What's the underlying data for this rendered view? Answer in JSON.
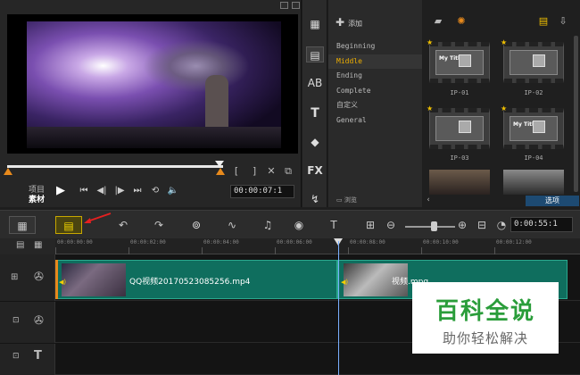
{
  "preview": {
    "mode_project": "项目",
    "mode_clip": "素材",
    "timecode": "00:00:07:1",
    "mark_in": "[",
    "mark_out": "]"
  },
  "library": {
    "add_label": "添加",
    "categories": [
      "Beginning",
      "Middle",
      "Ending",
      "Complete",
      "自定义",
      "General"
    ],
    "selected_category": "Middle",
    "browse_label": "浏览",
    "thumbnails": [
      {
        "label": "IP-01",
        "text": "My Title"
      },
      {
        "label": "IP-02",
        "text": ""
      },
      {
        "label": "IP-03",
        "text": ""
      },
      {
        "label": "IP-04",
        "text": "My Title"
      }
    ],
    "options_label": "选项"
  },
  "timeline": {
    "timecode": "0:00:55:1",
    "ruler_ticks": [
      "00:00:00:00",
      "00:00:02:00",
      "00:00:04:00",
      "00:00:06:00",
      "00:00:08:00",
      "00:00:10:00",
      "00:00:12:00"
    ],
    "clips": [
      {
        "name": "QQ视频20170523085256.mp4"
      },
      {
        "name": "视频.mpg"
      }
    ],
    "accent_color": "#0f6e5e",
    "selected_tool_color": "#f5d800"
  },
  "watermark": {
    "title": "百科全说",
    "subtitle": "助你轻松解决"
  }
}
